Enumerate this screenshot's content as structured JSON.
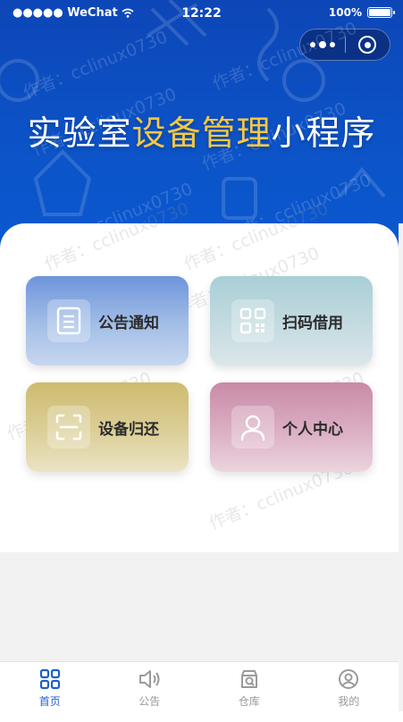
{
  "status_bar": {
    "carrier": "●●●●● WeChat",
    "time": "12:22",
    "battery_text": "100%",
    "battery_level": 1.0
  },
  "capsule": {
    "more_icon": "more-dots-icon",
    "close_icon": "close-mini-program-icon"
  },
  "hero": {
    "title_part1": "实验室",
    "title_highlight": "设备管理",
    "title_part2": "小程序",
    "highlight_color": "#f5c842",
    "background_color": "#0c52c6"
  },
  "watermark": "作者：cclinux0730",
  "menu": [
    {
      "label": "公告通知",
      "icon": "notice-document-icon"
    },
    {
      "label": "扫码借用",
      "icon": "qr-code-icon"
    },
    {
      "label": "设备归还",
      "icon": "scan-frame-icon"
    },
    {
      "label": "个人中心",
      "icon": "user-profile-icon"
    }
  ],
  "tabbar": {
    "active_color": "#1f5fc9",
    "items": [
      {
        "label": "首页",
        "icon": "home-grid-icon",
        "active": true
      },
      {
        "label": "公告",
        "icon": "speaker-icon",
        "active": false
      },
      {
        "label": "仓库",
        "icon": "warehouse-search-icon",
        "active": false
      },
      {
        "label": "我的",
        "icon": "user-icon",
        "active": false
      }
    ]
  }
}
